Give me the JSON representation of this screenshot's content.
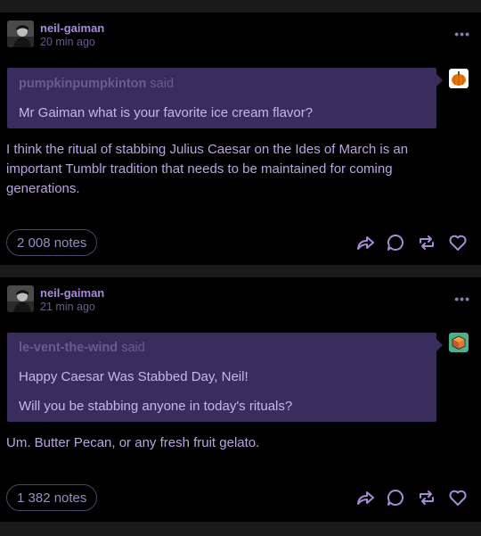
{
  "posts": [
    {
      "username": "neil-gaiman",
      "timestamp": "20 min ago",
      "more_label": "•••",
      "asker": "pumpkinpumpkinton",
      "said": "said",
      "question_lines": [
        "Mr Gaiman what is your favorite ice cream flavor?"
      ],
      "answer": "I think the ritual of stabbing Julius Caesar on the Ides of March is an important Tumblr tradition that needs to be maintained for coming generations.",
      "notes": "2 008 notes",
      "asker_avatar_icon": "pumpkin-icon"
    },
    {
      "username": "neil-gaiman",
      "timestamp": "21 min ago",
      "more_label": "•••",
      "asker": "le-vent-the-wind",
      "said": "said",
      "question_lines": [
        "Happy Caesar Was Stabbed Day, Neil!",
        "Will you be stabbing anyone in today's rituals?"
      ],
      "answer": "Um. Butter Pecan, or any fresh fruit gelato.",
      "notes": "1 382 notes",
      "asker_avatar_icon": "cube-icon"
    }
  ],
  "actions": [
    "share-icon",
    "reply-icon",
    "reblog-icon",
    "like-icon"
  ],
  "colors": {
    "background": "#000000",
    "ask_box": "#3b2c5e",
    "accent": "#a78bd8"
  }
}
